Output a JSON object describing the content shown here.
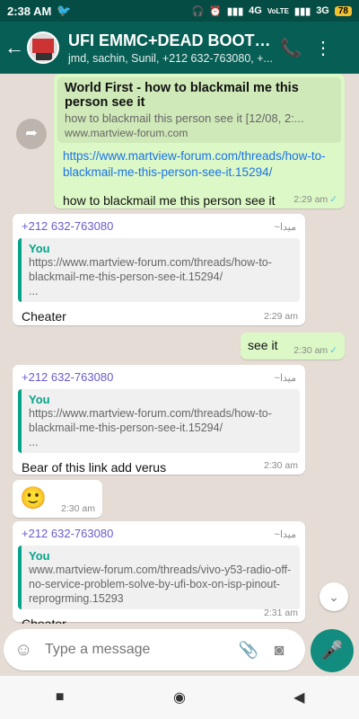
{
  "status_bar": {
    "time": "2:38 AM",
    "network_4g": "4G",
    "network_volte": "VoLTE",
    "network_3g": "3G",
    "battery": "78"
  },
  "toolbar": {
    "title": "UFI EMMC+DEAD BOOT FI...",
    "subtitle": "jmd, sachin, Sunil, +212 632-763080, +..."
  },
  "messages": [
    {
      "id": "m1",
      "preview_title": "World First - how to blackmail me this person see it",
      "preview_desc": "how to blackmail this person see it [12/08, 2:...",
      "preview_domain": "www.martview-forum.com",
      "link": "https://www.martview-forum.com/threads/how-to-blackmail-me-this-person-see-it.15294/",
      "text": "how to blackmail me  this person see it",
      "time": "2:29 am"
    },
    {
      "id": "m2",
      "sender": "+212 632-763080",
      "sender_alt": "~ميدا",
      "quote_author": "You",
      "quote_text": "https://www.martview-forum.com/threads/how-to-blackmail-me-this-person-see-it.15294/",
      "quote_more": "...",
      "text": "Cheater",
      "time": "2:29 am"
    },
    {
      "id": "m3",
      "text": "see it",
      "time": "2:30 am"
    },
    {
      "id": "m4",
      "sender": "+212 632-763080",
      "sender_alt": "~ميدا",
      "quote_author": "You",
      "quote_text": "https://www.martview-forum.com/threads/how-to-blackmail-me-this-person-see-it.15294/",
      "quote_more": "...",
      "text": "Bear of this link add verus",
      "time": "2:30 am"
    },
    {
      "id": "m5",
      "text": "🙂",
      "time": "2:30 am"
    },
    {
      "id": "m6",
      "sender": "+212 632-763080",
      "sender_alt": "~ميدا",
      "quote_author": "You",
      "quote_text": "www.martview-forum.com/threads/vivo-y53-radio-off-no-service-problem-solve-by-ufi-box-on-isp-pinout-reprogrming.15293",
      "text": "Cheater",
      "time": "2:31 am"
    }
  ],
  "composer": {
    "placeholder": "Type a message"
  },
  "colors": {
    "header": "#075e54",
    "outgoing": "#dcf8c6",
    "incoming": "#ffffff",
    "accent": "#128c7e",
    "link": "#1a73e8"
  }
}
